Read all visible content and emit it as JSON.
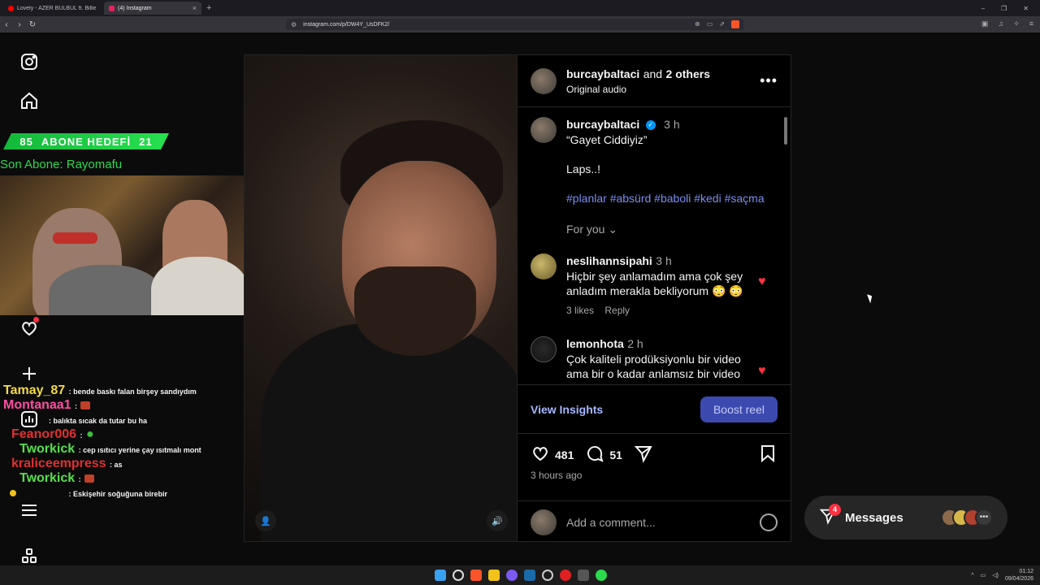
{
  "browser": {
    "tabs": [
      {
        "label": "Lovely - AZER BÜLBÜL ft. Billie Eilish",
        "icon": "youtube-icon",
        "active": false
      },
      {
        "label": "(4) Instagram",
        "icon": "instagram-icon",
        "active": true
      }
    ],
    "url": "instagram.com/p/DW4Y_UsDFK2/"
  },
  "overlay": {
    "goal_left": "85",
    "goal_label": "ABONE HEDEFİ",
    "goal_right": "21",
    "last_sub": "Son Abone: Rayomafu"
  },
  "chat": [
    {
      "user": "Tamay_87",
      "user_color": "#f2d94a",
      "text": ": bende baskı falan birşey sandıydım"
    },
    {
      "user": "Montanaa1",
      "user_color": "#ff4fa3",
      "text": ":"
    },
    {
      "user": "",
      "user_color": "#ffffff",
      "text": ": balıkta sıcak da tutar bu ha"
    },
    {
      "user": "Feanor006",
      "user_color": "#e03030",
      "text": ":"
    },
    {
      "user": "Tworkick",
      "user_color": "#55e04a",
      "text": ": cep ısıtıcı yerine çay ısıtmalı mont"
    },
    {
      "user": "kraliceempress",
      "user_color": "#e03030",
      "text": ": as"
    },
    {
      "user": "Tworkick",
      "user_color": "#55e04a",
      "text": ":"
    },
    {
      "user": "",
      "user_color": "#ffffff",
      "text": ": Eskişehir soğuğuna birebir"
    }
  ],
  "post": {
    "header_user": "burcaybaltaci",
    "header_and": "and",
    "header_others": "2 others",
    "audio": "Original audio",
    "caption_user": "burcaybaltaci",
    "caption_time": "3 h",
    "caption_line1": "“Gayet Ciddiyiz”",
    "caption_line2": "Laps..!",
    "hashtags": "#planlar #absürd #baboli #kedi #saçma",
    "for_you": "For you",
    "comments": [
      {
        "user": "neslihannsipahi",
        "time": "3 h",
        "text": "Hiçbir şey anlamadım ama çok şey anladım merakla bekliyorum 😳 😳",
        "likes": "3 likes",
        "reply": "Reply"
      },
      {
        "user": "lemonhota",
        "time": "2 h",
        "text": "Çok kaliteli prodüksiyonlu bir video ama bir o kadar anlamsız bir video ilginç bir deneyimdi sevdim"
      }
    ],
    "view_insights": "View Insights",
    "boost": "Boost reel",
    "likes": "481",
    "comments_count": "51",
    "time_ago": "3 hours ago",
    "comment_placeholder": "Add a comment..."
  },
  "messages": {
    "label": "Messages",
    "badge": "4"
  },
  "taskbar": {
    "time": "01:12",
    "date": "09/04/2026"
  }
}
